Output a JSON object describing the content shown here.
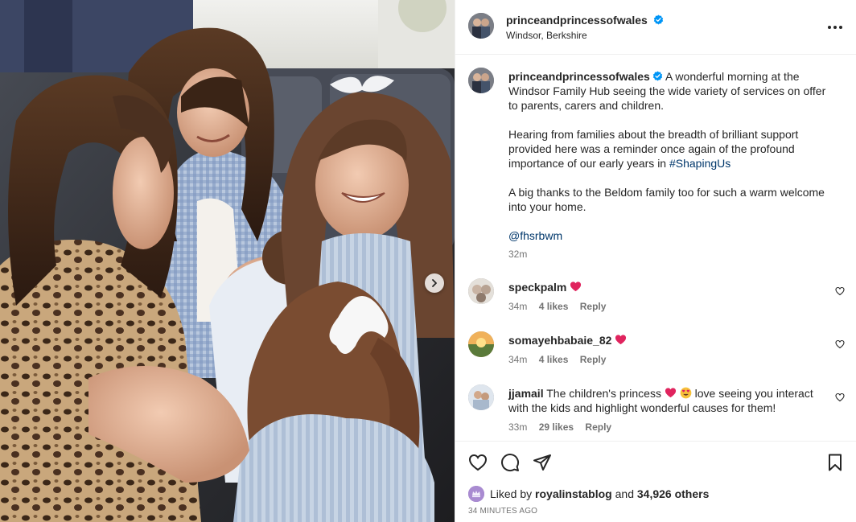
{
  "post": {
    "username": "princeandprincessofwales",
    "location": "Windsor, Berkshire",
    "caption_p1": "A wonderful morning at the Windsor Family Hub seeing the wide variety of services on offer to parents, carers and children.",
    "caption_p2_text": "Hearing from families about the breadth of brilliant support provided here was a reminder once again of the profound importance of our early years in ",
    "caption_p2_hashtag": "#ShapingUs",
    "caption_p3": "A big thanks to the Beldom family too for such a warm welcome into your home.",
    "caption_mention": "@fhsrbwm",
    "caption_age": "32m"
  },
  "comments": [
    {
      "user": "speckpalm",
      "text": "",
      "emojis": [
        "red-heart"
      ],
      "age": "34m",
      "likes": "4 likes",
      "reply": "Reply"
    },
    {
      "user": "somayehbabaie_82",
      "text": "",
      "emojis": [
        "red-heart"
      ],
      "age": "34m",
      "likes": "4 likes",
      "reply": "Reply"
    },
    {
      "user": "jjamail",
      "text_a": "The children's princess ",
      "text_b": " love seeing you interact with the kids and highlight wonderful causes for them!",
      "emojis": [
        "red-heart",
        "heart-eyes"
      ],
      "age": "33m",
      "likes": "29 likes",
      "reply": "Reply"
    }
  ],
  "likes_bar": {
    "prefix": "Liked by ",
    "liker": "royalinstablog",
    "middle": " and ",
    "others": "34,926 others",
    "timestamp": "34 MINUTES AGO"
  },
  "icons": {
    "verified": "verified-badge-icon",
    "more": "more-options-icon",
    "like": "heart-icon",
    "comment": "comment-icon",
    "share": "share-icon",
    "save": "bookmark-icon",
    "next": "chevron-right-icon"
  },
  "colors": {
    "verified_blue": "#0095f6",
    "link_blue": "#00376b",
    "muted": "#737373"
  }
}
